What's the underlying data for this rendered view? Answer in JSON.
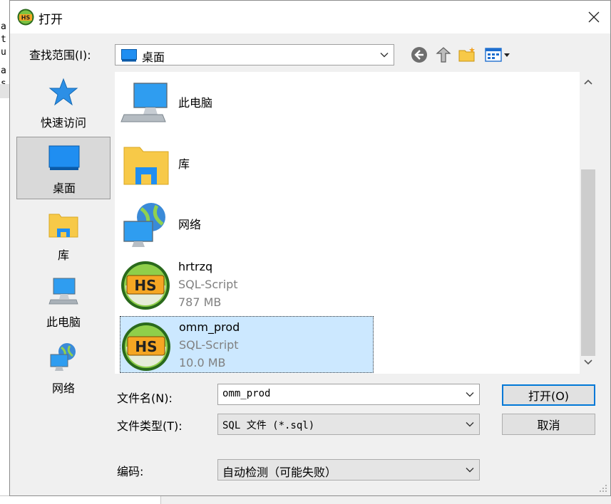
{
  "background_app": {
    "code_chars": [
      "a",
      "t",
      "u",
      "a",
      "s"
    ]
  },
  "dialog": {
    "title": "打开",
    "app_icon_text": "HS"
  },
  "lookin": {
    "label": "查找范围(I):",
    "value": "桌面"
  },
  "places": [
    {
      "label": "快速访问",
      "icon": "star-icon"
    },
    {
      "label": "桌面",
      "icon": "desktop-icon",
      "selected": true
    },
    {
      "label": "库",
      "icon": "library-icon"
    },
    {
      "label": "此电脑",
      "icon": "computer-icon"
    },
    {
      "label": "网络",
      "icon": "network-icon"
    }
  ],
  "files": [
    {
      "name": "此电脑",
      "icon": "computer-icon"
    },
    {
      "name": "库",
      "icon": "library-icon"
    },
    {
      "name": "网络",
      "icon": "network-icon"
    },
    {
      "name": "hrtrzq",
      "type": "SQL-Script",
      "size": "787 MB",
      "icon": "heidisql-icon"
    },
    {
      "name": "omm_prod",
      "type": "SQL-Script",
      "size": "10.0 MB",
      "icon": "heidisql-icon",
      "selected": true
    }
  ],
  "form": {
    "filename_label": "文件名(N):",
    "filename_value": "omm_prod",
    "filetype_label": "文件类型(T):",
    "filetype_value": "SQL 文件 (*.sql)",
    "encoding_label": "编码:",
    "encoding_value": "自动检测（可能失败）",
    "open_label": "打开(O)",
    "cancel_label": "取消"
  },
  "colors": {
    "selection": "#cce8ff",
    "accent": "#0078d7"
  }
}
